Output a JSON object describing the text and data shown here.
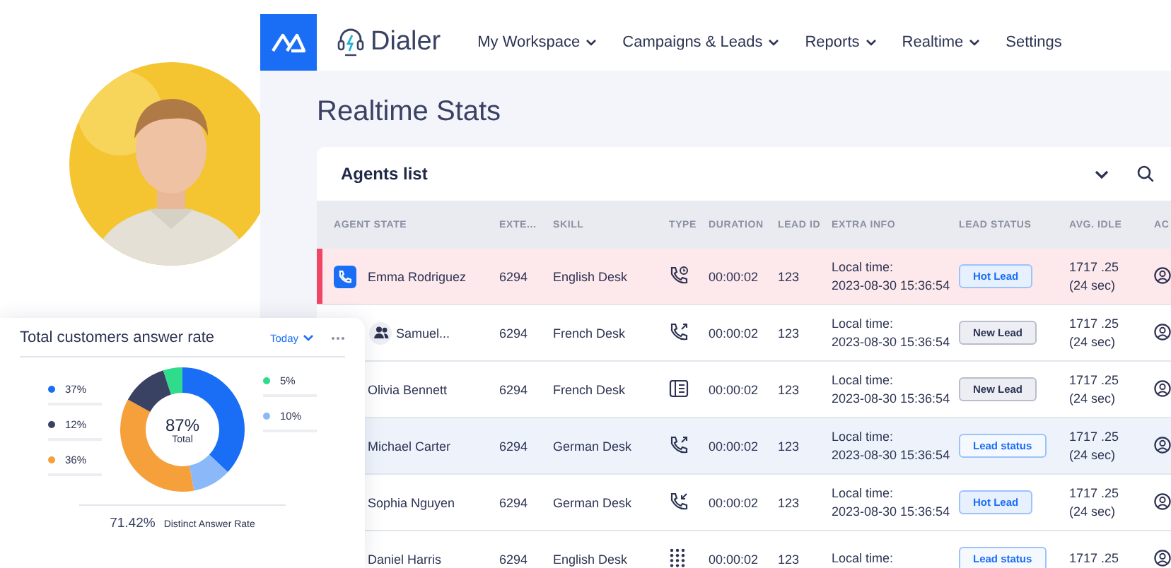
{
  "brand": {
    "name": "Dialer"
  },
  "nav": [
    {
      "label": "My Workspace",
      "dropdown": true
    },
    {
      "label": "Campaigns & Leads",
      "dropdown": true
    },
    {
      "label": "Reports",
      "dropdown": true
    },
    {
      "label": "Realtime",
      "dropdown": true
    },
    {
      "label": "Settings",
      "dropdown": false
    }
  ],
  "page_title": "Realtime Stats",
  "agents_card": {
    "title": "Agents list",
    "columns": [
      "AGENT STATE",
      "EXTE...",
      "SKILL",
      "TYPE",
      "DURATION",
      "LEAD ID",
      "EXTRA INFO",
      "LEAD STATUS",
      "AVG. IDLE",
      "AC"
    ],
    "rows": [
      {
        "agent": "Emma Rodriguez",
        "avatar": {
          "kind": "call"
        },
        "alert": true,
        "selected": false,
        "ext": "6294",
        "skill": "English Desk",
        "type_icon": {
          "kind": "phone-clock"
        },
        "duration": "00:00:02",
        "lead_id": "123",
        "info": [
          "Local time:",
          "2023-08-30 15:36:54"
        ],
        "status": {
          "label": "Hot Lead",
          "kind": "hot"
        },
        "idle": [
          "1717 .25",
          "(24 sec)"
        ]
      },
      {
        "agent": "Samuel...",
        "avatar": {
          "kind": "group"
        },
        "alert": false,
        "selected": false,
        "ext": "6294",
        "skill": "French Desk",
        "type_icon": {
          "kind": "phone-out"
        },
        "duration": "00:00:02",
        "lead_id": "123",
        "info": [
          "Local time:",
          "2023-08-30 15:36:54"
        ],
        "status": {
          "label": "New Lead",
          "kind": "new"
        },
        "idle": [
          "1717 .25",
          "(24 sec)"
        ]
      },
      {
        "agent": "Olivia Bennett",
        "alert": false,
        "selected": false,
        "ext": "6294",
        "skill": "French Desk",
        "type_icon": {
          "kind": "contact-card"
        },
        "duration": "00:00:02",
        "lead_id": "123",
        "info": [
          "Local time:",
          "2023-08-30 15:36:54"
        ],
        "status": {
          "label": "New Lead",
          "kind": "new"
        },
        "idle": [
          "1717 .25",
          "(24 sec)"
        ]
      },
      {
        "agent": "Michael Carter",
        "alert": false,
        "selected": true,
        "ext": "6294",
        "skill": "German Desk",
        "type_icon": {
          "kind": "phone-out"
        },
        "duration": "00:00:02",
        "lead_id": "123",
        "info": [
          "Local time:",
          "2023-08-30 15:36:54"
        ],
        "status": {
          "label": "Lead status",
          "kind": "status"
        },
        "idle": [
          "1717 .25",
          "(24 sec)"
        ]
      },
      {
        "agent": "Sophia Nguyen",
        "alert": false,
        "selected": false,
        "ext": "6294",
        "skill": "German Desk",
        "type_icon": {
          "kind": "phone-in"
        },
        "duration": "00:00:02",
        "lead_id": "123",
        "info": [
          "Local time:",
          "2023-08-30 15:36:54"
        ],
        "status": {
          "label": "Hot Lead",
          "kind": "hot"
        },
        "idle": [
          "1717 .25",
          "(24 sec)"
        ]
      },
      {
        "agent": "Daniel Harris",
        "alert": false,
        "selected": false,
        "ext": "6294",
        "skill": "English Desk",
        "type_icon": {
          "kind": "keypad"
        },
        "duration": "00:00:02",
        "lead_id": "123",
        "info": [
          "Local time:"
        ],
        "status": {
          "label": "Lead status",
          "kind": "status"
        },
        "idle": [
          "1717 .25"
        ]
      }
    ]
  },
  "answer_card": {
    "title": "Total customers answer rate",
    "period": "Today",
    "legend_left": [
      {
        "label": "37%",
        "color": "#1a6ef5"
      },
      {
        "label": "12%",
        "color": "#3a4264"
      },
      {
        "label": "36%",
        "color": "#f6a03c"
      }
    ],
    "legend_right": [
      {
        "label": "5%",
        "color": "#2fdc8c"
      },
      {
        "label": "10%",
        "color": "#8ab8f8"
      }
    ],
    "chart_data": {
      "type": "donut",
      "series": [
        {
          "values": [
            37,
            10,
            36,
            12,
            5
          ]
        }
      ],
      "colors": [
        "#1a6ef5",
        "#8ab8f8",
        "#f6a03c",
        "#3a4264",
        "#2fdc8c"
      ]
    },
    "center_value": "87%",
    "center_label": "Total",
    "footer_value": "71.42%",
    "footer_label": "Distinct Answer Rate"
  }
}
